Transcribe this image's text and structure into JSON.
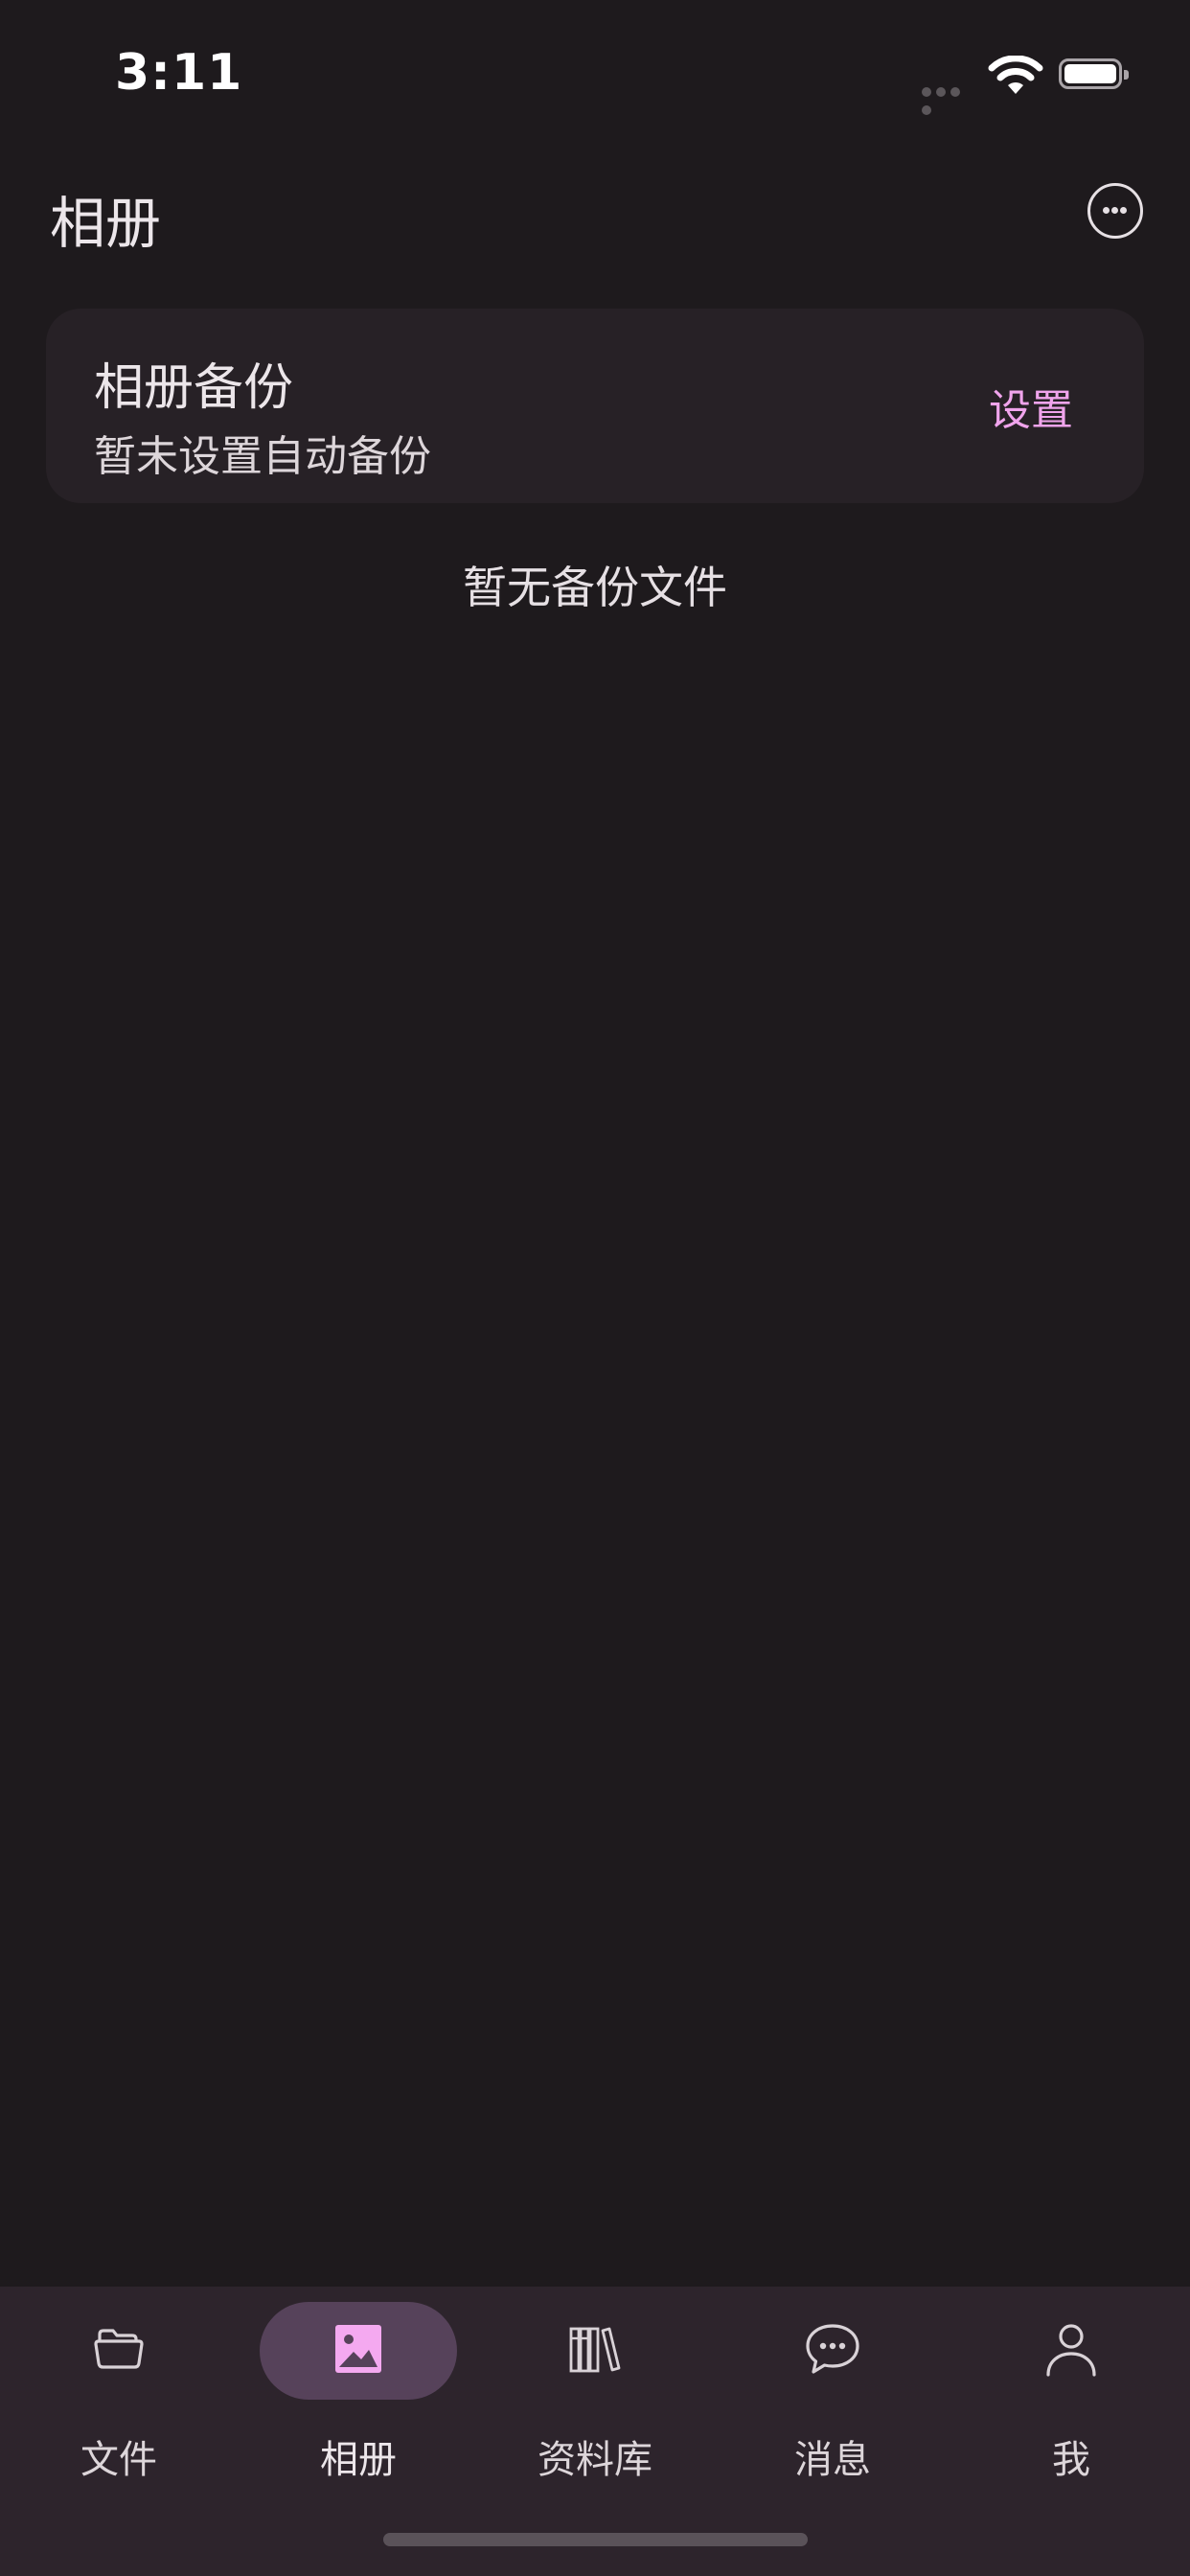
{
  "status_bar": {
    "time": "3:11",
    "signal_icon": "signal-dots-icon",
    "wifi_icon": "wifi-icon",
    "battery_icon": "battery-icon"
  },
  "header": {
    "title": "相册",
    "more_icon": "ellipsis-circle-icon"
  },
  "backup_card": {
    "title": "相册备份",
    "subtitle": "暂未设置自动备份",
    "settings_label": "设置"
  },
  "empty_state": {
    "text": "暂无备份文件"
  },
  "tab_bar": {
    "tabs": [
      {
        "label": "文件",
        "icon": "folder-icon",
        "active": false
      },
      {
        "label": "相册",
        "icon": "photo-icon",
        "active": true
      },
      {
        "label": "资料库",
        "icon": "library-books-icon",
        "active": false
      },
      {
        "label": "消息",
        "icon": "chat-bubble-icon",
        "active": false
      },
      {
        "label": "我",
        "icon": "person-icon",
        "active": false
      }
    ]
  },
  "colors": {
    "background": "#1e1a1d",
    "card": "#272126",
    "accent": "#f0a4ec",
    "tab_bar": "#2d242c",
    "active_pill": "#56425a"
  }
}
